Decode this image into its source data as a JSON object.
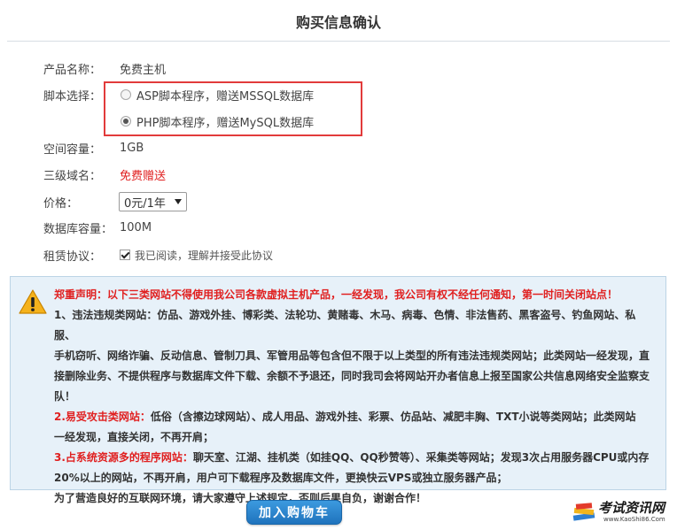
{
  "header": {
    "title": "购买信息确认"
  },
  "form": {
    "product": {
      "label": "产品名称：",
      "value": "免费主机"
    },
    "script": {
      "label": "脚本选择：",
      "options": [
        {
          "label": "ASP脚本程序，赠送MSSQL数据库",
          "selected": false
        },
        {
          "label": "PHP脚本程序，赠送MySQL数据库",
          "selected": true
        }
      ]
    },
    "space": {
      "label": "空间容量：",
      "value": "1GB"
    },
    "domain": {
      "label": "三级域名：",
      "value": "免费赠送"
    },
    "price": {
      "label": "价格：",
      "selected": "0元/1年"
    },
    "db": {
      "label": "数据库容量：",
      "value": "100M"
    },
    "agreement": {
      "label": "租赁协议：",
      "checkbox_label": "我已阅读，理解并接受此协议",
      "checked": true
    }
  },
  "notice": {
    "title": "郑重声明：以下三类网站不得使用我公司各款虚拟主机产品，一经发现，我公司有权不经任何通知，第一时间关闭站点！",
    "item1_line1": "1、违法违规类网站：仿品、游戏外挂、博彩类、法轮功、黄赌毒、木马、病毒、色情、非法售药、黑客盗号、钓鱼网站、私服、",
    "item1_line2": "手机窃听、网络诈骗、反动信息、管制刀具、军管用品等包含但不限于以上类型的所有违法违规类网站；此类网站一经发现，直",
    "item1_line3": "接删除业务、不提供程序与数据库文件下载、余额不予退还，同时我司会将网站开办者信息上报至国家公共信息网络安全监察支",
    "item1_line4": "队！",
    "item2_lead": "2.易受攻击类网站：",
    "item2_line1_rest": "低俗（含擦边球网站）、成人用品、游戏外挂、彩票、仿品站、减肥丰胸、TXT小说等类网站；此类网站",
    "item2_line2": "一经发现，直接关闭，不再开肩；",
    "item3_lead": "3.占系统资源多的程序网站：",
    "item3_line1_rest": "聊天室、江湖、挂机类（如挂QQ、QQ秒赞等）、采集类等网站；发现3次占用服务器CPU或内存",
    "item3_line2": "20%以上的网站，不再开肩，用户可下载程序及数据库文件，更换快云VPS或独立服务器产品；",
    "closing": "为了营造良好的互联网环境，请大家遵守上述规定，否则后果自负，谢谢合作！"
  },
  "actions": {
    "add_to_cart": "加入购物车"
  },
  "watermark": {
    "name": "考试资讯网",
    "url": "www.KaoShi86.Com"
  },
  "colors": {
    "accent_red": "#e02020",
    "button_blue": "#1f73bd",
    "notice_bg": "#e7f1f9"
  }
}
